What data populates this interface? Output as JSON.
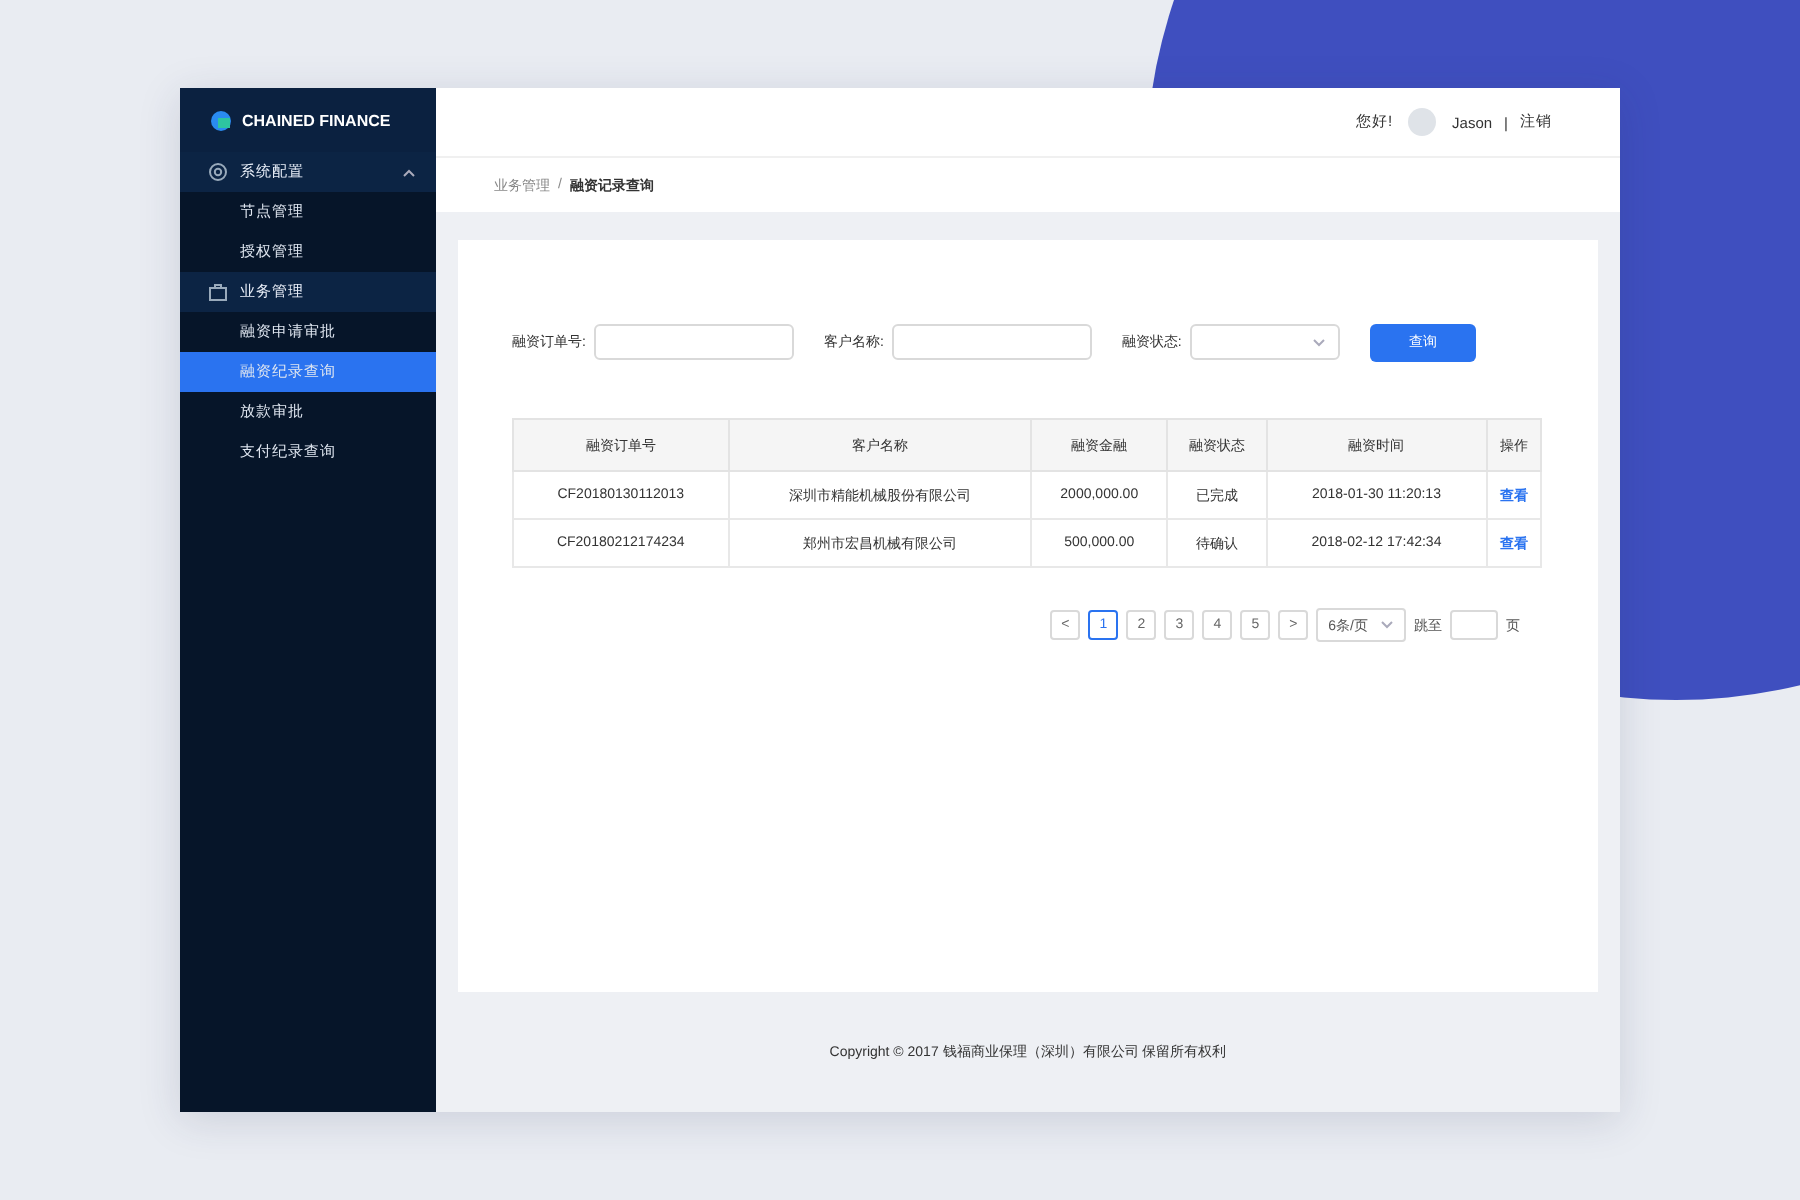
{
  "logo": {
    "text": "CHAINED FINANCE"
  },
  "sidebar": {
    "groups": [
      {
        "label": "系统配置",
        "kind": "settings",
        "expanded": true,
        "items": [
          {
            "label": "节点管理",
            "selected": false
          },
          {
            "label": "授权管理",
            "selected": false
          }
        ]
      },
      {
        "label": "业务管理",
        "kind": "business",
        "expanded": true,
        "items": [
          {
            "label": "融资申请审批",
            "selected": false
          },
          {
            "label": "融资纪录查询",
            "selected": true
          },
          {
            "label": "放款审批",
            "selected": false
          },
          {
            "label": "支付纪录查询",
            "selected": false
          }
        ]
      }
    ]
  },
  "header": {
    "greeting": "您好!",
    "user": "Jason",
    "separator": "|",
    "logout": "注销"
  },
  "breadcrumb": {
    "parent": "业务管理",
    "separator": "/",
    "current": "融资记录查询"
  },
  "filters": [
    {
      "kind": "input",
      "label": "融资订单号:"
    },
    {
      "kind": "input",
      "label": "客户名称:"
    },
    {
      "kind": "select",
      "label": "融资状态:"
    }
  ],
  "search_button": "查询",
  "table": {
    "columns": [
      "融资订单号",
      "客户名称",
      "融资金融",
      "融资状态",
      "融资时间",
      "操作"
    ],
    "rows": [
      [
        "CF20180130112013",
        "深圳市精能机械股份有限公司",
        "2000,000.00",
        "已完成",
        "2018-01-30 11:20:13",
        "查看"
      ],
      [
        "CF20180212174234",
        "郑州市宏昌机械有限公司",
        "500,000.00",
        "待确认",
        "2018-02-12 17:42:34",
        "查看"
      ]
    ]
  },
  "pagination": {
    "prev": "<",
    "pages": [
      {
        "label": "1",
        "selected": true
      },
      {
        "label": "2",
        "selected": false
      },
      {
        "label": "3",
        "selected": false
      },
      {
        "label": "4",
        "selected": false
      },
      {
        "label": "5",
        "selected": false
      }
    ],
    "next": ">",
    "page_size": "6条/页",
    "jump_label": "跳至",
    "jump_unit": "页"
  },
  "footer": "Copyright © 2017 钱福商业保理（深圳）有限公司 保留所有权利"
}
